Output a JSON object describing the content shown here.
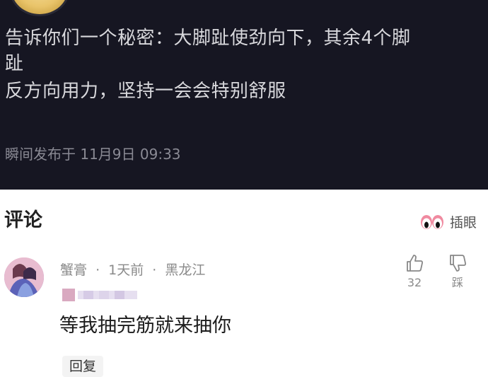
{
  "post": {
    "lines": [
      "告诉你们一个秘密：大脚趾使劲向下，其余4个脚",
      "趾",
      "反方向用力，坚持一会会特别舒服"
    ],
    "time": "瞬间发布于 11月9日 09:33"
  },
  "comments_section": {
    "title": "评论",
    "eyes_label": "插眼"
  },
  "comment": {
    "username": "蟹膏",
    "dot": "·",
    "time_ago": "1天前",
    "location": "黑龙江",
    "text": "等我抽完筋就来抽你",
    "reply_label": "回复",
    "like_count": "32",
    "dislike_label": "踩"
  },
  "colors": {
    "post_bg": "#161622",
    "post_text": "#d8d8dc",
    "meta_gray": "#8a8a8a",
    "eyes_pink": "#f08aa0"
  }
}
